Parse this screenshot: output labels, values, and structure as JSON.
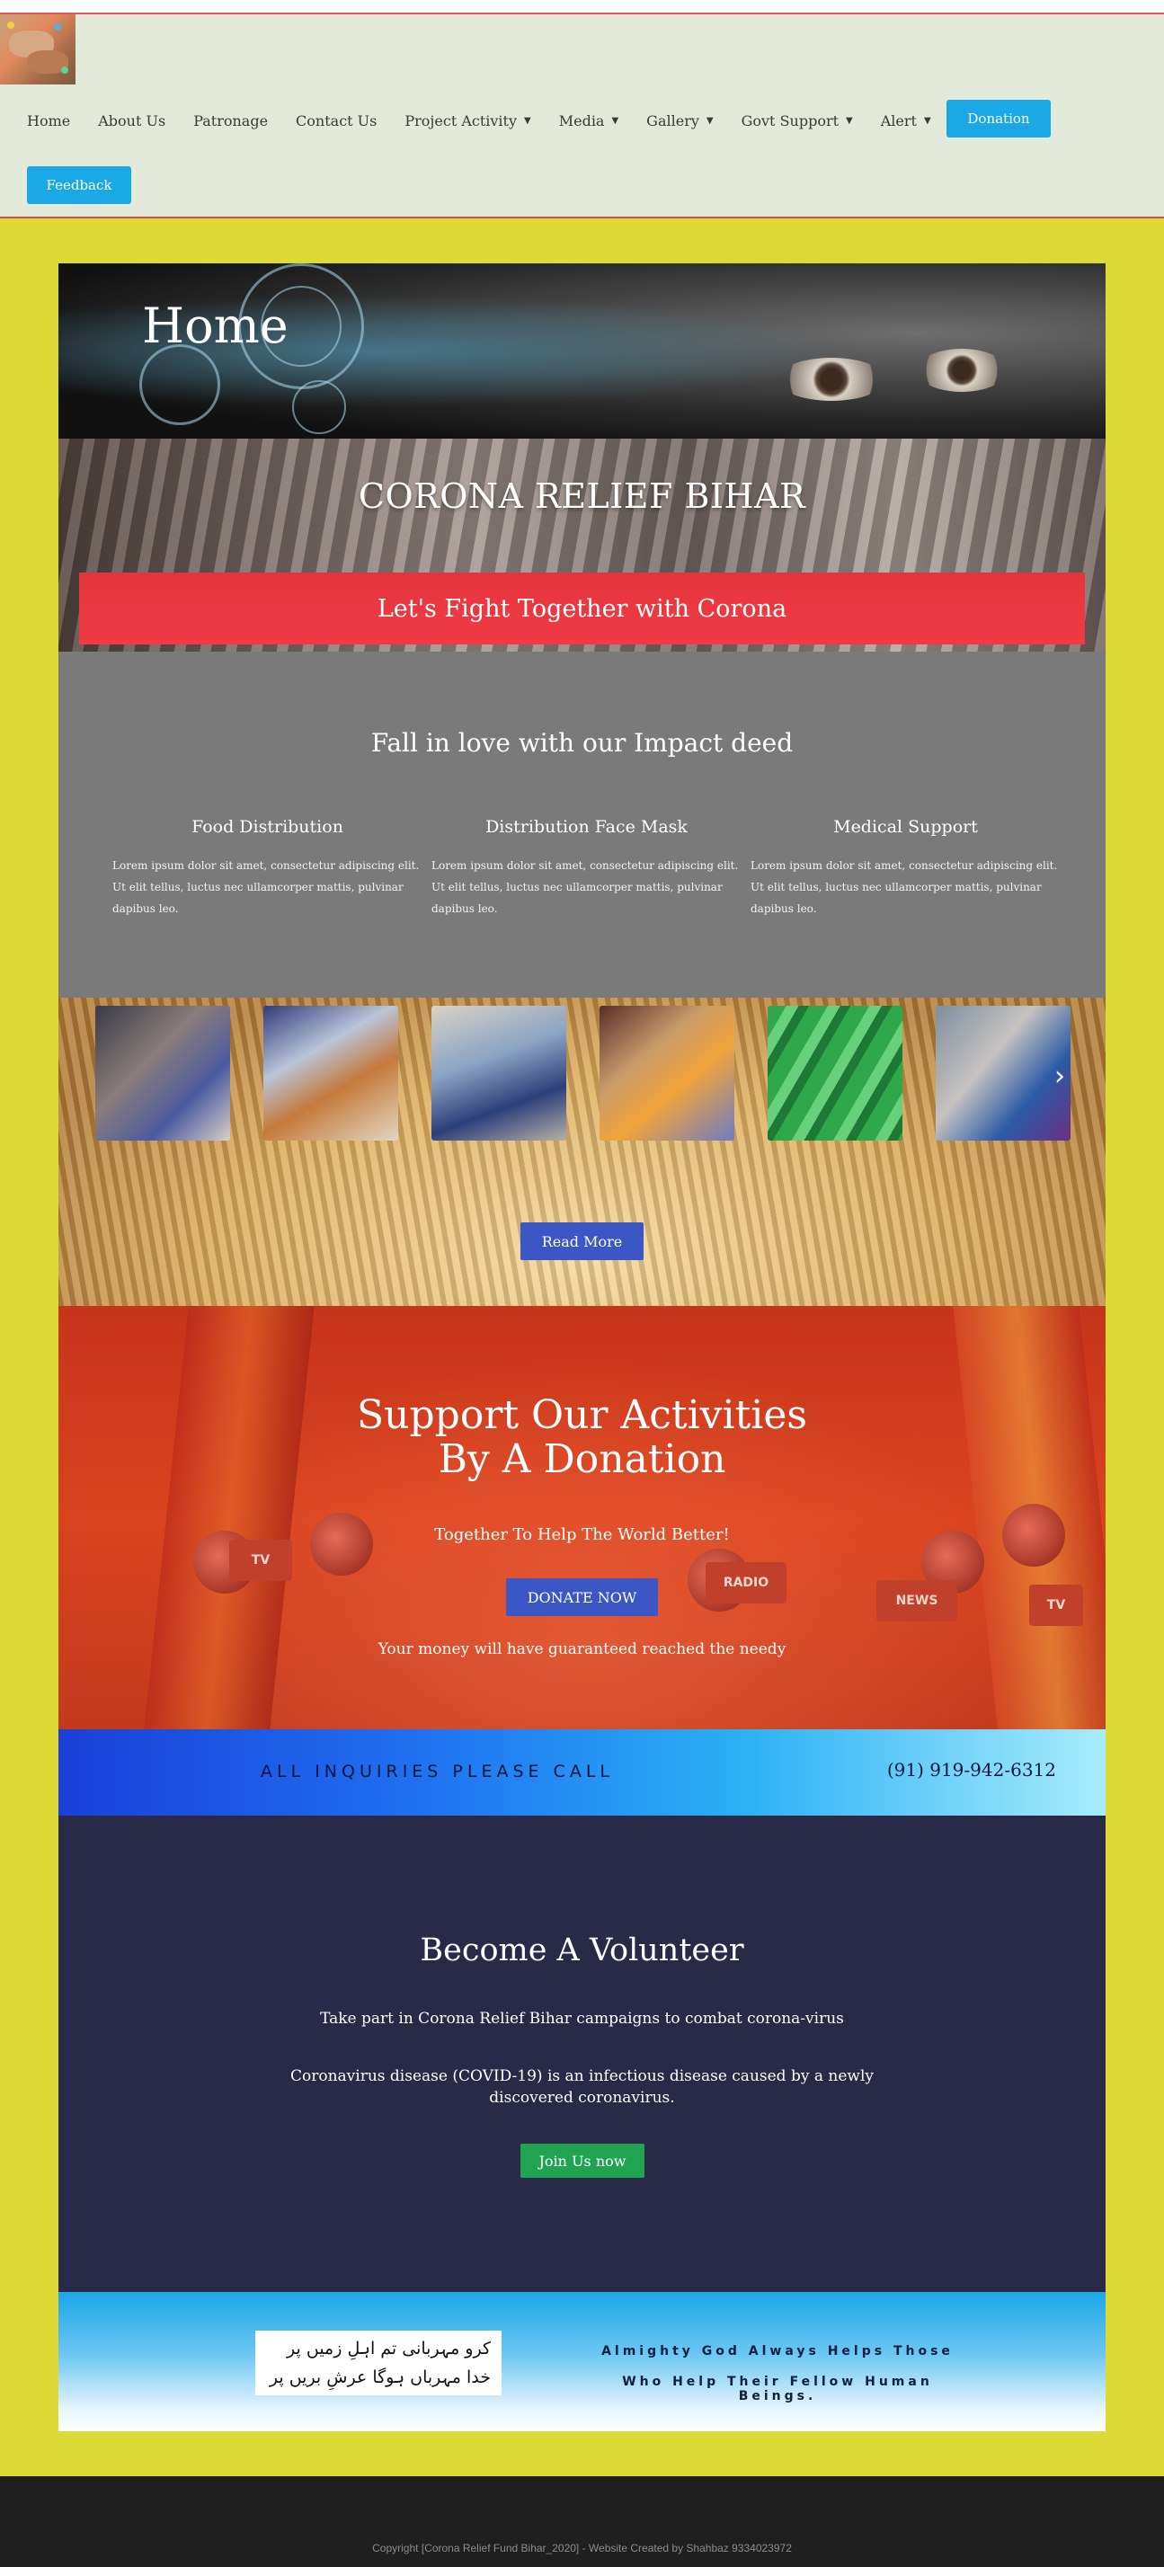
{
  "nav": {
    "items": [
      {
        "label": "Home",
        "dropdown": false
      },
      {
        "label": "About Us",
        "dropdown": false
      },
      {
        "label": "Patronage",
        "dropdown": false
      },
      {
        "label": "Contact Us",
        "dropdown": false
      },
      {
        "label": "Project Activity",
        "dropdown": true
      },
      {
        "label": "Media",
        "dropdown": true
      },
      {
        "label": "Gallery",
        "dropdown": true
      },
      {
        "label": "Govt Support",
        "dropdown": true
      },
      {
        "label": "Alert",
        "dropdown": true
      }
    ],
    "donation_label": "Donation",
    "feedback_label": "Feedback"
  },
  "hero": {
    "page_title": "Home",
    "org_title": "CORONA RELIEF BIHAR",
    "banner_text": "Let's Fight Together with Corona"
  },
  "impact": {
    "heading": "Fall in love with our Impact deed",
    "columns": [
      {
        "title": "Food Distribution",
        "text": "Lorem ipsum dolor sit amet, consectetur adipiscing elit. Ut elit tellus, luctus nec ullamcorper mattis, pulvinar dapibus leo."
      },
      {
        "title": "Distribution Face Mask",
        "text": "Lorem ipsum dolor sit amet, consectetur adipiscing elit. Ut elit tellus, luctus nec ullamcorper mattis, pulvinar dapibus leo."
      },
      {
        "title": "Medical Support",
        "text": "Lorem ipsum dolor sit amet, consectetur adipiscing elit. Ut elit tellus, luctus nec ullamcorper mattis, pulvinar dapibus leo."
      }
    ]
  },
  "gallery": {
    "read_more_label": "Read More",
    "next_arrow": "›"
  },
  "donate": {
    "heading_line1": "Support Our Activities",
    "heading_line2": "By A Donation",
    "subtitle": "Together To Help The World Better!",
    "button_label": "DONATE NOW",
    "note": "Your money will have guaranteed reached the needy",
    "mic_labels": [
      "TV",
      "RADIO",
      "NEWS",
      "TV"
    ]
  },
  "inquiry": {
    "label": "ALL INQUIRIES PLEASE CALL",
    "phone": "(91) 919-942-6312"
  },
  "volunteer": {
    "heading": "Become A Volunteer",
    "line1": "Take part in Corona Relief Bihar campaigns to combat corona-virus",
    "line2": "Coronavirus disease (COVID-19) is an infectious disease caused by a newly discovered coronavirus.",
    "button_label": "Join Us now"
  },
  "quote": {
    "urdu_line1": "کرو مہربانی تم اہلِ زمیں پر",
    "urdu_line2": "خدا مہرباں ہوگا عرشِ بریں پر",
    "motto_line1": "Almighty God Always Helps Those",
    "motto_line2": "Who Help Their Fellow Human Beings."
  },
  "footer": {
    "copyright": "Copyright [Corona Relief Fund Bihar_2020] - Website Created by Shahbaz 9334023972"
  },
  "colors": {
    "page_bg": "#ddda35",
    "header_bg": "#e4ead9",
    "button_cyan": "#1aa8e6",
    "banner_red": "#f03b45",
    "button_blue": "#3b56c5",
    "button_green": "#20a452",
    "volunteer_bg": "#292a48"
  }
}
